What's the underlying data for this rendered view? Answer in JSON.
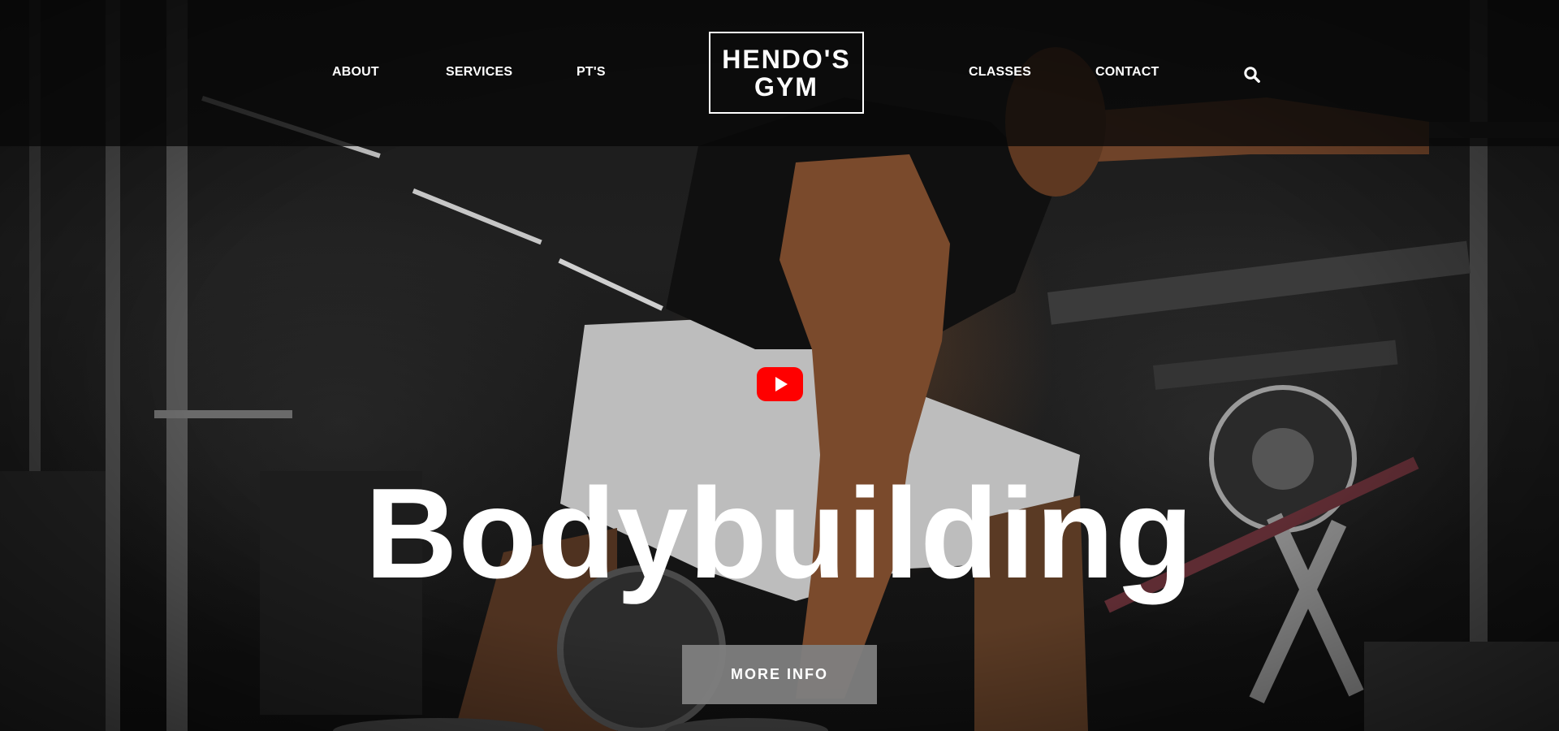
{
  "header": {
    "nav_left": [
      {
        "label": "ABOUT"
      },
      {
        "label": "SERVICES"
      },
      {
        "label": "PT'S"
      }
    ],
    "logo": {
      "line1": "HENDO'S",
      "line2": "GYM"
    },
    "nav_right": [
      {
        "label": "CLASSES"
      },
      {
        "label": "CONTACT"
      }
    ],
    "search_icon": "search-icon"
  },
  "hero": {
    "video_icon": "youtube-play-icon",
    "title": "Bodybuilding",
    "cta_label": "MORE INFO"
  },
  "colors": {
    "header_bg": "#080808",
    "text": "#ffffff",
    "play_button": "#ff0000",
    "cta_bg": "#808080"
  }
}
